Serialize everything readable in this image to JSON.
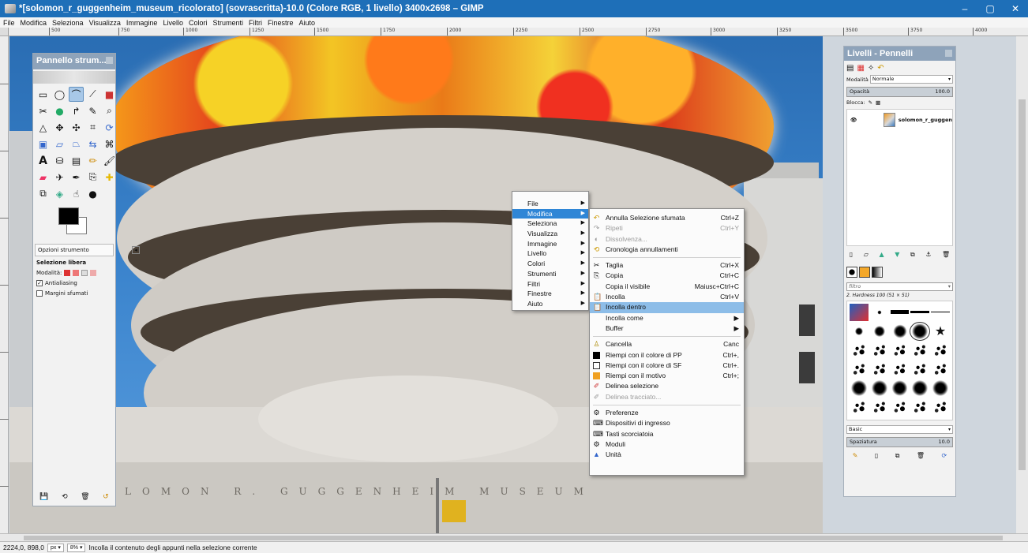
{
  "window": {
    "title": "*[solomon_r_guggenheim_museum_ricolorato] (sovrascritta)-10.0 (Colore RGB, 1 livello) 3400x2698 – GIMP",
    "minimize": "–",
    "maximize": "▢",
    "close": "✕"
  },
  "menubar": [
    "File",
    "Modifica",
    "Seleziona",
    "Visualizza",
    "Immagine",
    "Livello",
    "Colori",
    "Strumenti",
    "Filtri",
    "Finestre",
    "Aiuto"
  ],
  "ruler": [
    "500",
    "750",
    "1000",
    "1250",
    "1500",
    "1750",
    "2000",
    "2250",
    "2500",
    "2750",
    "3000",
    "3250",
    "3500",
    "3750",
    "4000"
  ],
  "toolbox": {
    "title": "Pannello strum...",
    "options_tab": "Opzioni strumento",
    "tool_name": "Selezione libera",
    "mode_label": "Modalità:",
    "antialias": "Antialiasing",
    "feather": "Margini sfumati"
  },
  "context_menu": {
    "items": [
      "File",
      "Modifica",
      "Seleziona",
      "Visualizza",
      "Immagine",
      "Livello",
      "Colori",
      "Strumenti",
      "Filtri",
      "Finestre",
      "Aiuto"
    ],
    "highlighted": "Modifica"
  },
  "edit_submenu": {
    "undo": {
      "label": "Annulla Selezione sfumata",
      "shortcut": "Ctrl+Z"
    },
    "redo": {
      "label": "Ripeti",
      "shortcut": "Ctrl+Y"
    },
    "fade": {
      "label": "Dissolvenza..."
    },
    "history": {
      "label": "Cronologia annullamenti"
    },
    "cut": {
      "label": "Taglia",
      "shortcut": "Ctrl+X"
    },
    "copy": {
      "label": "Copia",
      "shortcut": "Ctrl+C"
    },
    "copy_visible": {
      "label": "Copia il visibile",
      "shortcut": "Maiusc+Ctrl+C"
    },
    "paste": {
      "label": "Incolla",
      "shortcut": "Ctrl+V"
    },
    "paste_into": {
      "label": "Incolla dentro"
    },
    "paste_as": {
      "label": "Incolla come"
    },
    "buffer": {
      "label": "Buffer"
    },
    "clear": {
      "label": "Cancella",
      "shortcut": "Canc"
    },
    "fill_fg": {
      "label": "Riempi con il colore di PP",
      "shortcut": "Ctrl+,"
    },
    "fill_bg": {
      "label": "Riempi con il colore di SF",
      "shortcut": "Ctrl+."
    },
    "fill_pattern": {
      "label": "Riempi con il motivo",
      "shortcut": "Ctrl+;"
    },
    "stroke_sel": {
      "label": "Delinea selezione"
    },
    "stroke_path": {
      "label": "Delinea tracciato..."
    },
    "prefs": {
      "label": "Preferenze"
    },
    "input_devices": {
      "label": "Dispositivi di ingresso"
    },
    "shortcuts": {
      "label": "Tasti scorciatoia"
    },
    "modules": {
      "label": "Moduli"
    },
    "units": {
      "label": "Unità"
    }
  },
  "dock": {
    "title": "Livelli - Pennelli",
    "mode_label": "Modalità",
    "mode_value": "Normale",
    "opacity_label": "Opacità",
    "opacity_value": "100.0",
    "lock_label": "Blocca:",
    "layer_name": "solomon_r_guggen",
    "filter_placeholder": "filtro",
    "brush_name": "2. Hardness 100 (51 × 51)",
    "brush_set": "Basic",
    "spacing_label": "Spaziatura",
    "spacing_value": "10.0"
  },
  "statusbar": {
    "coords": "2224,0, 898,0",
    "unit": "px",
    "zoom": "8%",
    "message": "Incolla il contenuto degli appunti nella selezione corrente"
  },
  "photo": {
    "facade_text": "SOLOMON R. GUGGENHEIM MUSEUM"
  },
  "colors": {
    "titlebar": "#1e6fb8",
    "menu_highlight": "#2f86d6",
    "submenu_highlight": "#8dbde8",
    "panel_header": "#8ea3ba"
  }
}
